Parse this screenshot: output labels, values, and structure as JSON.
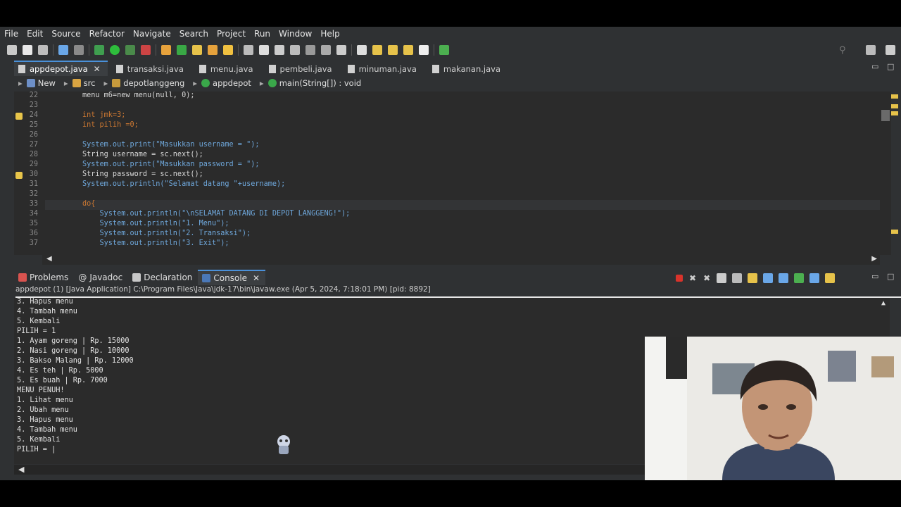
{
  "menu": [
    "File",
    "Edit",
    "Source",
    "Refactor",
    "Navigate",
    "Search",
    "Project",
    "Run",
    "Window",
    "Help"
  ],
  "editor_tabs": [
    {
      "label": "appdepot.java",
      "active": true,
      "closable": true
    },
    {
      "label": "transaksi.java",
      "active": false
    },
    {
      "label": "menu.java",
      "active": false
    },
    {
      "label": "pembeli.java",
      "active": false
    },
    {
      "label": "minuman.java",
      "active": false
    },
    {
      "label": "makanan.java",
      "active": false
    }
  ],
  "breadcrumb": [
    "New",
    "src",
    "depotlanggeng",
    "appdepot",
    "main(String[]) : void"
  ],
  "code_lines": [
    {
      "n": "22",
      "text": "menu m6=new menu(null, 0);"
    },
    {
      "n": "23",
      "text": ""
    },
    {
      "n": "24",
      "text": "int jmk=3;"
    },
    {
      "n": "25",
      "text": "int pilih =0;"
    },
    {
      "n": "26",
      "text": ""
    },
    {
      "n": "27",
      "text": "System.out.print(\"Masukkan username = \");"
    },
    {
      "n": "28",
      "text": "String username = sc.next();"
    },
    {
      "n": "29",
      "text": "System.out.print(\"Masukkan password = \");"
    },
    {
      "n": "30",
      "text": "String password = sc.next();"
    },
    {
      "n": "31",
      "text": "System.out.println(\"Selamat datang \"+username);"
    },
    {
      "n": "32",
      "text": ""
    },
    {
      "n": "33",
      "text": "do{"
    },
    {
      "n": "34",
      "text": "    System.out.println(\"\\nSELAMAT DATANG DI DEPOT LANGGENG!\");"
    },
    {
      "n": "35",
      "text": "    System.out.println(\"1. Menu\");"
    },
    {
      "n": "36",
      "text": "    System.out.println(\"2. Transaksi\");"
    },
    {
      "n": "37",
      "text": "    System.out.println(\"3. Exit\");"
    }
  ],
  "panel_tabs": [
    {
      "label": "Problems",
      "active": false
    },
    {
      "label": "Javadoc",
      "active": false
    },
    {
      "label": "Declaration",
      "active": false
    },
    {
      "label": "Console",
      "active": true,
      "closable": true
    }
  ],
  "console_header": "appdepot (1) [Java Application] C:\\Program Files\\Java\\jdk-17\\bin\\javaw.exe  (Apr 5, 2024, 7:18:01 PM) [pid: 8892]",
  "console_lines": [
    "3. Hapus menu",
    "4. Tambah menu",
    "5. Kembali",
    "PILIH = 1",
    "1. Ayam goreng | Rp. 15000",
    "2. Nasi goreng | Rp. 10000",
    "3. Bakso Malang | Rp. 12000",
    "4. Es teh | Rp. 5000",
    "5. Es buah | Rp. 7000",
    "MENU PENUH!",
    "1. Lihat menu",
    "2. Ubah menu",
    "3. Hapus menu",
    "4. Tambah menu",
    "5. Kembali",
    "PILIH = |"
  ],
  "icons": {
    "close": "close-icon",
    "warning": "warning-marker-icon",
    "terminate": "stop-icon"
  },
  "colors": {
    "accent": "#4a90d9",
    "keyword": "#cc7832",
    "warning": "#e8c54a",
    "terminate": "#d9332b"
  }
}
